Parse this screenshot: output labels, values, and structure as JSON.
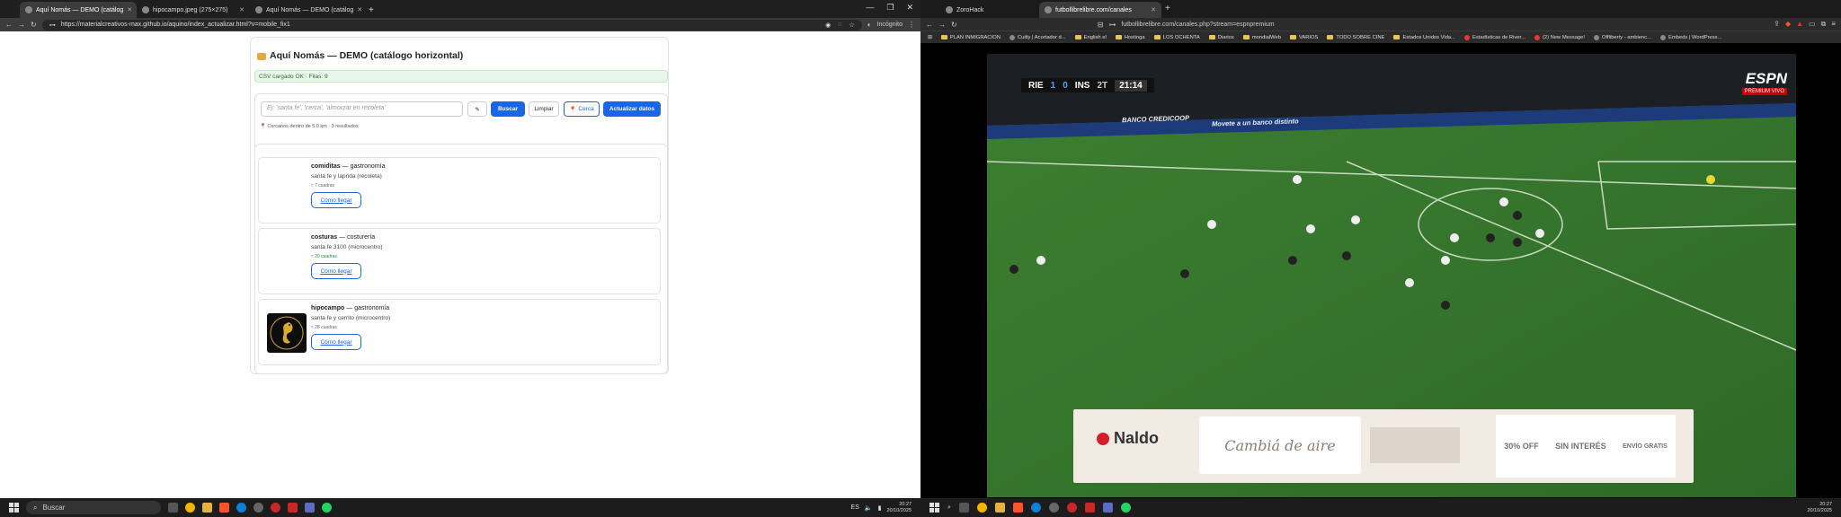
{
  "left_browser": {
    "tabs": [
      {
        "title": "Aquí Nomás — DEMO (catálog",
        "active": true
      },
      {
        "title": "hipocampo.jpeg (275×275)",
        "active": false
      },
      {
        "title": "Aquí Nomás — DEMO (catálog",
        "active": false
      }
    ],
    "url": "https://materialcreativos-max.github.io/aquino/index_actualizar.html?v=mobile_fix1",
    "incognito_label": "Incógnito"
  },
  "page": {
    "title": "Aquí Nomás — DEMO (catálogo horizontal)",
    "status": "CSV cargado OK · Filas: 9",
    "search_placeholder": "Ej: 'santa fe', 'cerca', 'almorzar en recoleta'",
    "buttons": {
      "search": "Buscar",
      "clear": "Limpiar",
      "near": "Cerca",
      "update": "Actualizar datos"
    },
    "results_note": "Cercanos dentro de 5.0 km · 3 resultados",
    "entries": [
      {
        "name": "comiditas",
        "category": "gastronomía",
        "address": "santa fe y laprida (recoleta)",
        "distance": "≈ 7 cuadras",
        "action": "Cómo llegar"
      },
      {
        "name": "costuras",
        "category": "costurería",
        "address": "santa fe 3100 (microcentro)",
        "distance": "≈ 20 cuadras",
        "action": "Cómo llegar"
      },
      {
        "name": "hipocampo",
        "category": "gastronomía",
        "address": "santa fe y cerrito (microcentro)",
        "distance": "≈ 28 cuadras",
        "action": "Cómo llegar"
      }
    ]
  },
  "left_taskbar": {
    "search_placeholder": "Buscar",
    "language": "ES",
    "time": "20:27",
    "date": "20/10/2025"
  },
  "right_browser": {
    "tabs": [
      {
        "title": "ZoroHack",
        "active": false
      },
      {
        "title": "futbollibrelibre.com/canales",
        "active": true
      }
    ],
    "url": "futbollibrelibre.com/canales.php?stream=espnpremium",
    "bookmarks": [
      "PLAN INMIGRACION",
      "Cuitly | Acortador d...",
      "English el",
      "Hostinga",
      "LOS OCHENTA",
      "Diarios",
      "mondialWeb",
      "VARIOS",
      "TODO SOBRE CINE",
      "Estados Unidos Vida...",
      "Estadísticas de River...",
      "(2) New Message!",
      "Offliberty - ambienc...",
      "Embeds | WordPress..."
    ]
  },
  "video": {
    "home_team": "RIE",
    "home_score": "1",
    "away_score": "0",
    "away_team": "INS",
    "period": "2T",
    "clock": "21:14",
    "channel": "ESPN",
    "channel_sub": "PREMIUM VIVO",
    "ad_brand": "Naldo",
    "ad_text": "Cambiá de aire",
    "ad_discount": "30% OFF",
    "ad_no_interest": "SIN INTERÉS",
    "ad_shipping": "ENVÍO GRATIS",
    "billboard": "BANCO CREDICOOP",
    "billboard2": "Movete a un banco distinto"
  },
  "right_taskbar": {
    "time": "20:27",
    "date": "20/10/2025"
  }
}
